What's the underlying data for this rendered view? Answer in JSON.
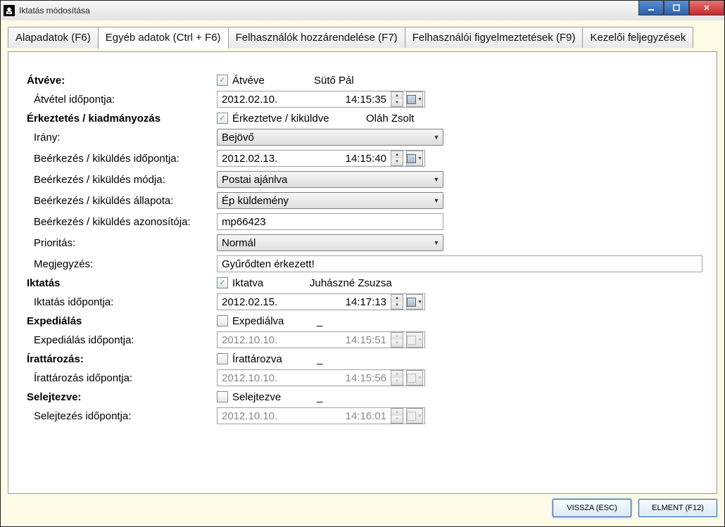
{
  "window": {
    "title": "Iktatás módosítása"
  },
  "tabs": {
    "alap": "Alapadatok (F6)",
    "egyeb": "Egyéb adatok (Ctrl + F6)",
    "felh": "Felhasználók hozzárendelése (F7)",
    "figy": "Felhasználói figyelmeztetések (F9)",
    "kezel": "Kezelői feljegyzések"
  },
  "labels": {
    "atveve": "Átvéve:",
    "atvetel_ido": "Átvétel időpontja:",
    "erkeztetes": "Érkeztetés / kiadmányozás",
    "irany": "Irány:",
    "beerk_ido": "Beérkezés / kiküldés időpontja:",
    "beerk_mod": "Beérkezés / kiküldés módja:",
    "beerk_allapot": "Beérkezés / kiküldés állapota:",
    "beerk_azon": "Beérkezés / kiküldés azonosítója:",
    "prioritas": "Prioritás:",
    "megj": "Megjegyzés:",
    "iktatas": "Iktatás",
    "iktatas_ido": "Iktatás időpontja:",
    "expedialas": "Expediálás",
    "expedialas_ido": "Expediálás időpontja:",
    "irattarozas": "Írattározás:",
    "irattarozas_ido": "Írattározás időpontja:",
    "selejtezve": "Selejtezve:",
    "selejtezes_ido": "Selejtezés időpontja:"
  },
  "checks": {
    "atveve": "Átvéve",
    "erkeztetve": "Érkeztetve / kiküldve",
    "iktatva": "Iktatva",
    "expedialva": "Expediálva",
    "irattarozva": "Írattározva",
    "selejtezve": "Selejtezve"
  },
  "people": {
    "atveve": "Sütő Pál",
    "erkeztetve": "Oláh Zsolt",
    "iktatva": "Juhászné Zsuzsa",
    "expedialva": "_",
    "irattarozva": "_",
    "selejtezve": "_"
  },
  "dates": {
    "atvetel": {
      "date": "2012.02.10.",
      "time": "14:15:35"
    },
    "beerk": {
      "date": "2012.02.13.",
      "time": "14:15:40"
    },
    "iktatas": {
      "date": "2012.02.15.",
      "time": "14:17:13"
    },
    "exped": {
      "date": "2012.10.10.",
      "time": "14:15:51"
    },
    "iratt": {
      "date": "2012.10.10.",
      "time": "14:15:56"
    },
    "selejt": {
      "date": "2012.10.10.",
      "time": "14:16:01"
    }
  },
  "combos": {
    "irany": "Bejövő",
    "beerk_mod": "Postai ajánlva",
    "beerk_allapot": "Ép küldemény",
    "prioritas": "Normál"
  },
  "inputs": {
    "beerk_azon": "mp66423",
    "megj": "Gyűrődten érkezett!"
  },
  "buttons": {
    "back": "VISSZA (ESC)",
    "save": "ELMENT (F12)"
  }
}
